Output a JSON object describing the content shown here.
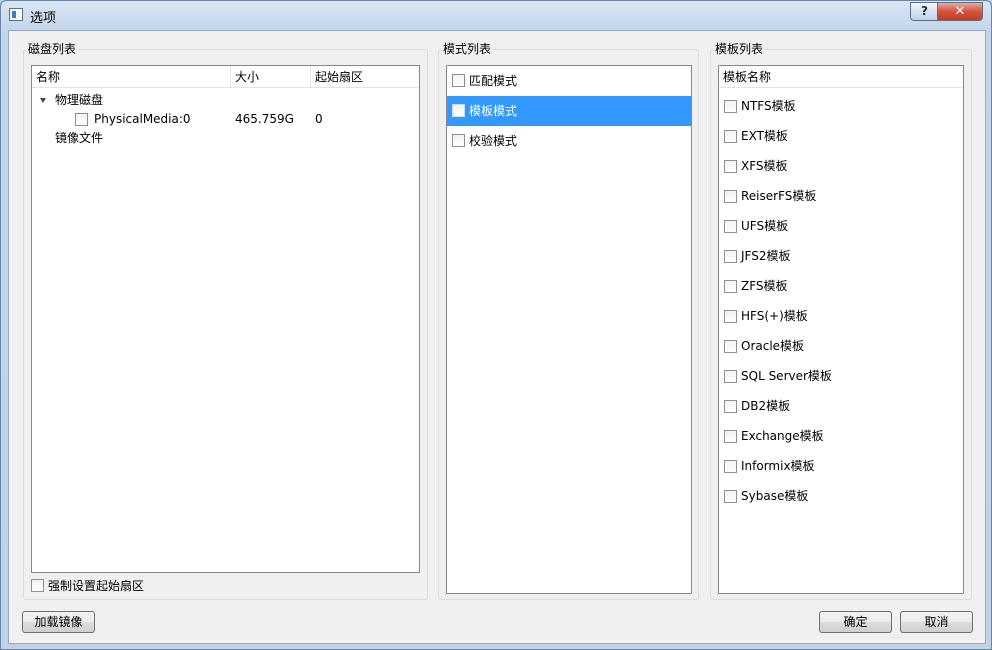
{
  "window": {
    "title": "选项",
    "help_label": "?",
    "close_label": "✕"
  },
  "disk": {
    "group_title": "磁盘列表",
    "columns": [
      "名称",
      "大小",
      "起始扇区"
    ],
    "physical_label": "物理磁盘",
    "media": {
      "name": "PhysicalMedia:0",
      "size": "465.759G",
      "start": "0"
    },
    "image_label": "镜像文件",
    "force_label": "强制设置起始扇区"
  },
  "mode": {
    "group_title": "模式列表",
    "items": [
      "匹配模式",
      "模板模式",
      "校验模式"
    ],
    "selected_index": 1
  },
  "template": {
    "group_title": "模板列表",
    "header": "模板名称",
    "items": [
      "NTFS模板",
      "EXT模板",
      "XFS模板",
      "ReiserFS模板",
      "UFS模板",
      "JFS2模板",
      "ZFS模板",
      "HFS(+)模板",
      "Oracle模板",
      "SQL Server模板",
      "DB2模板",
      "Exchange模板",
      "Informix模板",
      "Sybase模板"
    ]
  },
  "buttons": {
    "load_image": "加载镜像",
    "ok": "确定",
    "cancel": "取消"
  },
  "colors": {
    "selection": "#3399ff",
    "close_button": "#c53b22"
  }
}
